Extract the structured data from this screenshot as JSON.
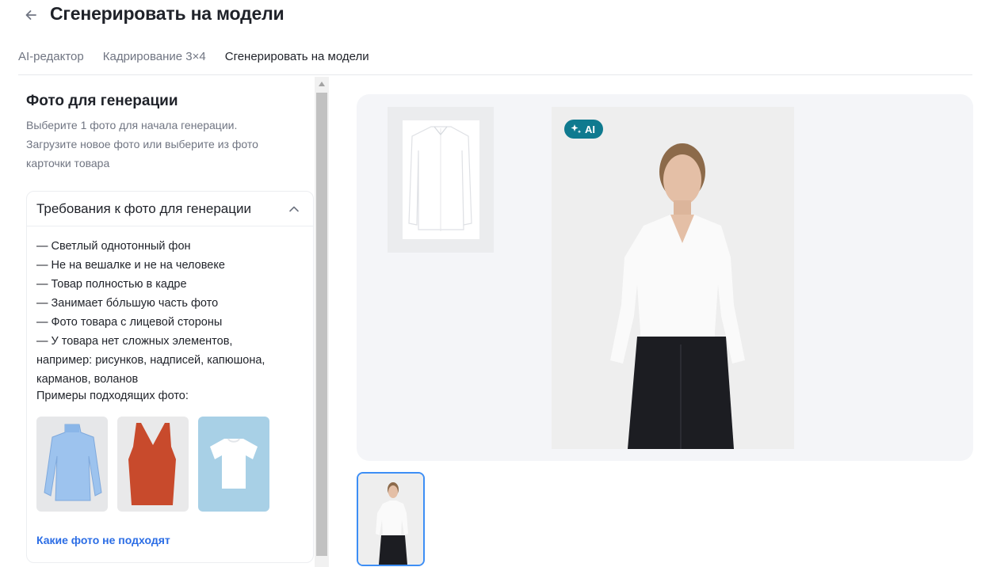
{
  "header": {
    "title": "Сгенерировать на модели",
    "back_icon": "arrow-left-icon"
  },
  "tabs": [
    {
      "label": "AI-редактор",
      "active": false
    },
    {
      "label": "Кадрирование 3×4",
      "active": false
    },
    {
      "label": "Сгенерировать на модели",
      "active": true
    }
  ],
  "left_panel": {
    "title": "Фото для генерации",
    "description_lines": [
      "Выберите 1 фото для начала генерации.",
      "Загрузите новое фото или выберите из фото",
      "карточки товара"
    ],
    "requirements": {
      "title": "Требования к фото для генерации",
      "expanded": true,
      "items": [
        "— Светлый однотонный фон",
        "— Не на вешалке и не на человеке",
        "— Товар полностью в кадре",
        "— Занимает бóльшую часть фото",
        "— Фото товара с лицевой стороны",
        "— У товара нет сложных элементов,",
        "например: рисунков, надписей, капюшона,",
        "карманов, воланов"
      ],
      "examples_label": "Примеры подходящих фото:",
      "bad_photos_link": "Какие фото не подходят"
    }
  },
  "preview": {
    "ai_badge": "AI"
  },
  "colors": {
    "accent_link": "#2b6de5",
    "ai_badge": "#0f7a8f",
    "selected_border": "#3d8ef5"
  }
}
